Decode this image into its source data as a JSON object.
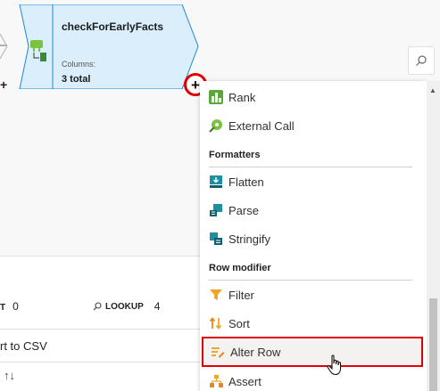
{
  "node": {
    "title": "checkForEarlyFacts",
    "columns_label": "Columns:",
    "columns_value": "3 total"
  },
  "canvas": {
    "plus_glyph": "+"
  },
  "bottom_panel": {
    "stat_label": "T",
    "stat_count": "0",
    "lookup_label": "LOOKUP",
    "lookup_count": "4",
    "csv_text": "rt to CSV",
    "sort_glyph": "↑↓"
  },
  "menu": {
    "items_top": [
      {
        "label": "Rank",
        "icon": "rank-icon"
      },
      {
        "label": "External Call",
        "icon": "external-call-icon"
      }
    ],
    "formatters_header": "Formatters",
    "formatters": [
      {
        "label": "Flatten",
        "icon": "flatten-icon"
      },
      {
        "label": "Parse",
        "icon": "parse-icon"
      },
      {
        "label": "Stringify",
        "icon": "stringify-icon"
      }
    ],
    "row_modifier_header": "Row modifier",
    "row_modifiers": [
      {
        "label": "Filter",
        "icon": "filter-icon"
      },
      {
        "label": "Sort",
        "icon": "sort-icon"
      },
      {
        "label": "Alter Row",
        "icon": "alter-row-icon"
      },
      {
        "label": "Assert",
        "icon": "assert-icon"
      }
    ]
  },
  "colors": {
    "node_fill": "#daeefc",
    "node_stroke": "#1c88d1",
    "highlight": "#e00000"
  }
}
